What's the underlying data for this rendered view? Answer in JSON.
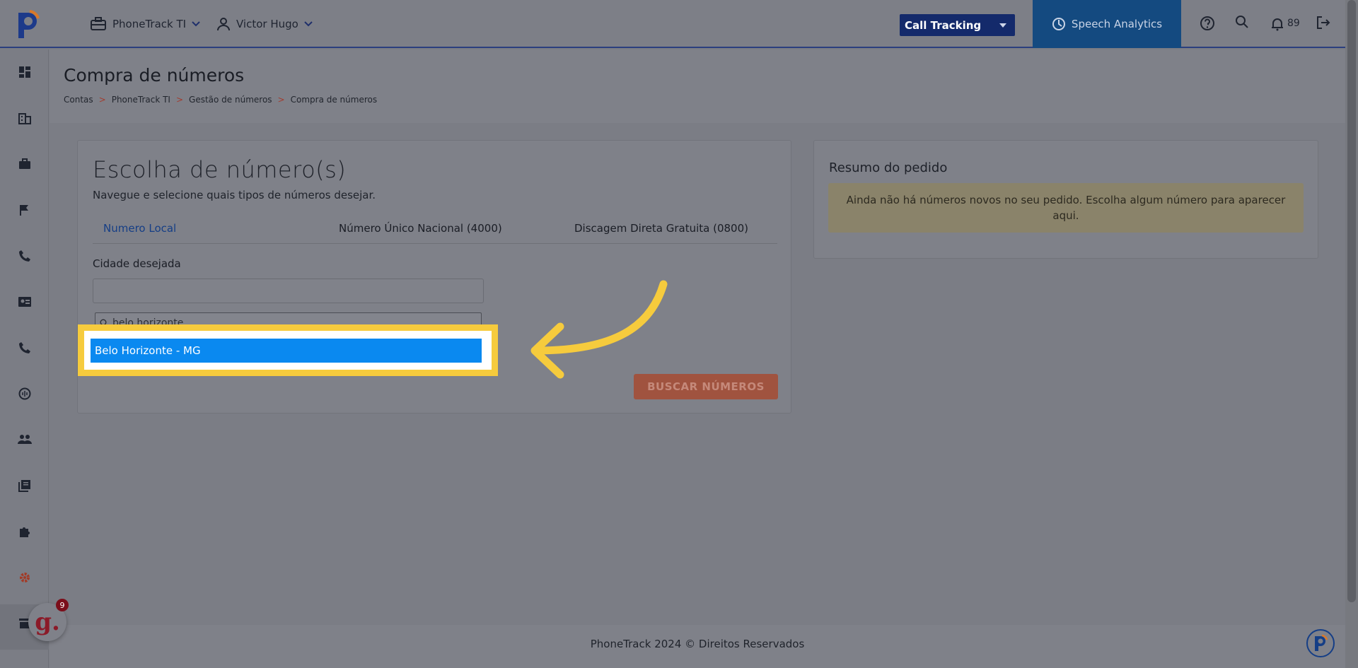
{
  "header": {
    "account": "PhoneTrack TI",
    "user": "Victor Hugo",
    "product_select": "Call Tracking",
    "speech_analytics": "Speech Analytics",
    "notifications_count": "89"
  },
  "page": {
    "title": "Compra de números",
    "breadcrumb": [
      "Contas",
      "PhoneTrack TI",
      "Gestão de números",
      "Compra de números"
    ],
    "breadcrumb_sep": ">"
  },
  "choose": {
    "title": "Escolha de número(s)",
    "subtitle": "Navegue e selecione quais tipos de números desejar.",
    "tabs": [
      "Numero Local",
      "Número Único Nacional (4000)",
      "Discagem Direta Gratuita (0800)"
    ],
    "city_label": "Cidade desejada",
    "search_value": "belo horizonte",
    "option": "Belo Horizonte - MG",
    "search_button": "BUSCAR NÚMEROS"
  },
  "summary": {
    "title": "Resumo do pedido",
    "empty_message": "Ainda não há números novos no seu pedido. Escolha algum número para aparecer aqui."
  },
  "footer": {
    "text": "PhoneTrack 2024 © Direitos Reservados"
  },
  "widgets": {
    "help_letter": "g.",
    "help_count": "9"
  },
  "colors": {
    "highlight": "#f6cb3d",
    "option_bg": "#0a89f0",
    "brand_blue": "#142a6b"
  }
}
